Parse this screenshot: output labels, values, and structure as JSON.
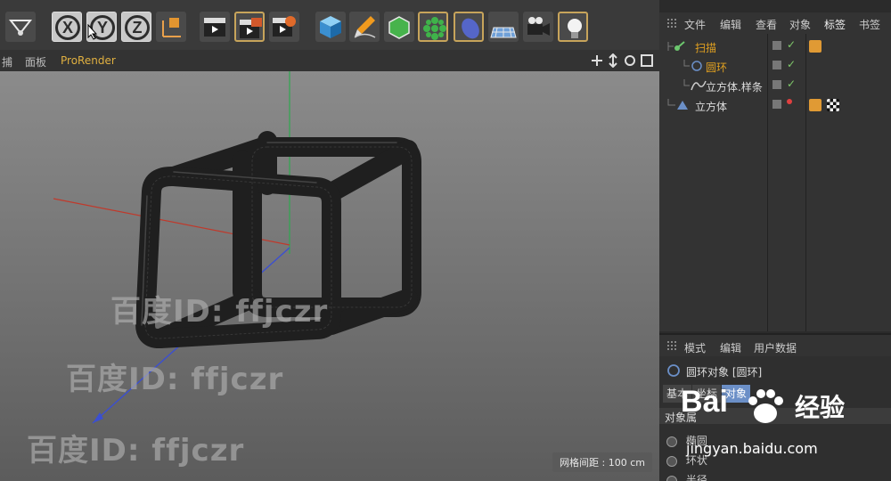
{
  "toolbar": {
    "buttons": [
      "move-tool",
      "axis-x",
      "axis-y",
      "axis-z",
      "coordinate-system",
      "render-view",
      "render-picture-viewer",
      "render-settings",
      "cube",
      "pen",
      "subdivision",
      "array",
      "deformer",
      "floor",
      "camera",
      "light"
    ],
    "axis_x": "X",
    "axis_y": "Y",
    "axis_z": "Z"
  },
  "viewport": {
    "menu": [
      "捕",
      "面板",
      "ProRender"
    ],
    "grid_spacing": "网格间距 : 100 cm",
    "watermarks": [
      "百度ID: ffjczr",
      "百度ID: ffjczr",
      "百度ID: ffjczr"
    ]
  },
  "object_manager": {
    "menu": [
      "文件",
      "编辑",
      "查看",
      "对象",
      "标签",
      "书签"
    ],
    "objects": [
      {
        "name": "扫描",
        "active": true
      },
      {
        "name": "圆环",
        "active": false
      },
      {
        "name": "立方体.样条",
        "active": false
      },
      {
        "name": "立方体",
        "active": false
      }
    ]
  },
  "attribute_manager": {
    "menu": [
      "模式",
      "编辑",
      "用户数据"
    ],
    "title": "圆环对象 [圆环]",
    "tabs": [
      "基本",
      "坐标",
      "对象"
    ],
    "section": "对象属",
    "radio_labels": [
      "椭圆",
      "环状",
      "半径"
    ]
  },
  "brand": {
    "logo_text": "Bai",
    "logo_word": "经验",
    "url": "jingyan.baidu.com"
  },
  "colors": {
    "accent_orange": "#e0a020",
    "selected_tab": "#6b8fc7",
    "axis_red": "#c0392b",
    "axis_green": "#2fa84f",
    "axis_blue": "#3b4fd1"
  }
}
